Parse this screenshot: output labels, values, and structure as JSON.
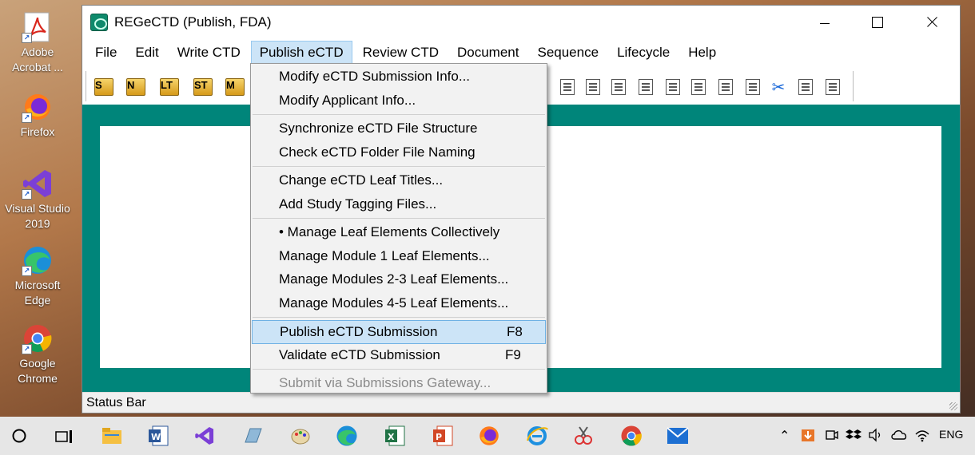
{
  "desktop": {
    "icons": [
      {
        "label": "Adobe Acrobat ..."
      },
      {
        "label": "Firefox"
      },
      {
        "label": "Visual Studio 2019"
      },
      {
        "label": "Microsoft Edge"
      },
      {
        "label": "Google Chrome"
      }
    ]
  },
  "window": {
    "title": "REGeCTD (Publish, FDA)"
  },
  "menubar": {
    "items": [
      "File",
      "Edit",
      "Write CTD",
      "Publish eCTD",
      "Review CTD",
      "Document",
      "Sequence",
      "Lifecycle",
      "Help"
    ]
  },
  "toolbar": {
    "left_icons": [
      "S",
      "N",
      "LT",
      "ST",
      "M"
    ]
  },
  "dropdown": {
    "items": [
      {
        "label": "Modify eCTD Submission Info..."
      },
      {
        "label": "Modify Applicant Info..."
      },
      {
        "label": "Synchronize eCTD File Structure"
      },
      {
        "label": "Check eCTD Folder File Naming"
      },
      {
        "label": "Change eCTD Leaf Titles..."
      },
      {
        "label": "Add Study Tagging Files..."
      },
      {
        "label": "• Manage Leaf Elements Collectively"
      },
      {
        "label": "Manage Module 1 Leaf Elements..."
      },
      {
        "label": "Manage Modules 2-3 Leaf Elements..."
      },
      {
        "label": "Manage Modules 4-5 Leaf Elements..."
      },
      {
        "label": "Publish eCTD Submission",
        "shortcut": "F8"
      },
      {
        "label": "Validate eCTD Submission",
        "shortcut": "F9"
      },
      {
        "label": "Submit via Submissions Gateway..."
      }
    ]
  },
  "status": {
    "text": "Status Bar"
  },
  "taskbar": {
    "language": "ENG"
  }
}
